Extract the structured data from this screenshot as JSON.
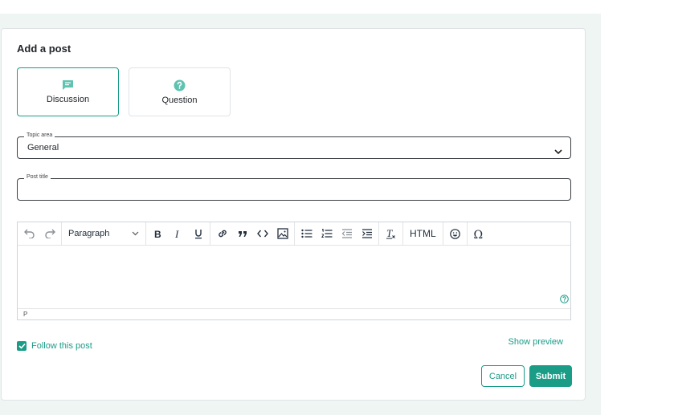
{
  "form": {
    "title": "Add a post",
    "post_types": [
      {
        "label": "Discussion",
        "icon": "chat-bubble-icon",
        "selected": true
      },
      {
        "label": "Question",
        "icon": "question-circle-icon",
        "selected": false
      }
    ],
    "topic_area": {
      "label": "Topic area",
      "value": "General"
    },
    "post_title": {
      "label": "Post title",
      "value": ""
    },
    "editor": {
      "block_format": "Paragraph",
      "html_label": "HTML",
      "status_path": "P",
      "toolbar_icons": [
        "undo-icon",
        "redo-icon",
        "bold-icon",
        "italic-icon",
        "underline-icon",
        "link-icon",
        "blockquote-icon",
        "code-icon",
        "image-icon",
        "bullet-list-icon",
        "numbered-list-icon",
        "outdent-icon",
        "indent-icon",
        "clear-formatting-icon",
        "emoji-icon",
        "special-character-icon",
        "help-icon"
      ]
    },
    "follow": {
      "label": "Follow this post",
      "checked": true
    },
    "show_preview": "Show preview",
    "cancel": "Cancel",
    "submit": "Submit"
  },
  "colors": {
    "accent": "#1a9c87",
    "accent_light": "#5ec3b1",
    "backdrop": "#eef5f3"
  }
}
